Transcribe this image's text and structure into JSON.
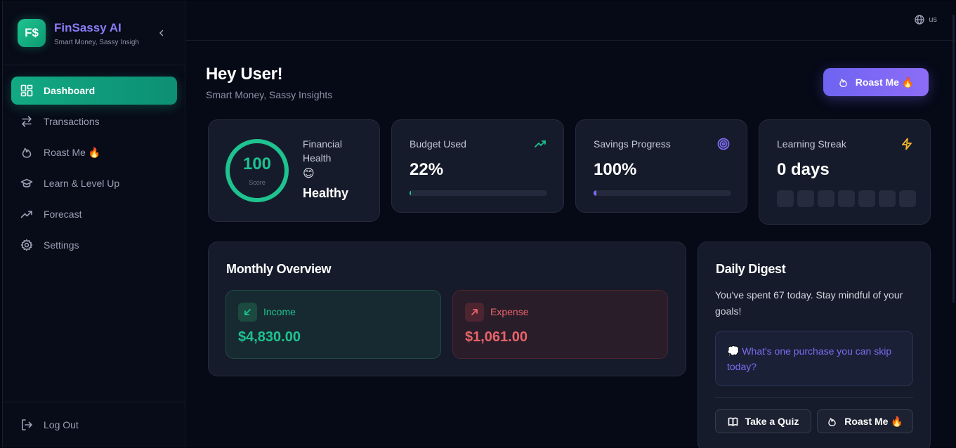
{
  "brand": {
    "logo": "F$",
    "name": "FinSassy AI",
    "tagline": "Smart Money, Sassy Insigh"
  },
  "nav": [
    {
      "label": "Dashboard",
      "icon": "dashboard-icon"
    },
    {
      "label": "Transactions",
      "icon": "arrows-icon"
    },
    {
      "label": "Roast Me 🔥",
      "icon": "flame-icon"
    },
    {
      "label": "Learn & Level Up",
      "icon": "graduation-cap-icon"
    },
    {
      "label": "Forecast",
      "icon": "trend-icon"
    },
    {
      "label": "Settings",
      "icon": "gear-icon"
    }
  ],
  "logout_label": "Log Out",
  "lang": "us",
  "header": {
    "greeting": "Hey User!",
    "subtitle": "Smart Money, Sassy Insights",
    "roast_button": "Roast Me 🔥"
  },
  "health": {
    "score": "100",
    "score_label": "Score",
    "label": "Financial Health",
    "emoji": "😊",
    "status": "Healthy",
    "progress": 1.0
  },
  "budget": {
    "label": "Budget Used",
    "value": "22%",
    "progress": 0.01
  },
  "savings": {
    "label": "Savings Progress",
    "value": "100%",
    "progress": 0.02
  },
  "streak": {
    "label": "Learning Streak",
    "value": "0 days",
    "days": 7
  },
  "overview": {
    "title": "Monthly Overview",
    "income": {
      "label": "Income",
      "value": "$4,830.00"
    },
    "expense": {
      "label": "Expense",
      "value": "$1,061.00"
    }
  },
  "digest": {
    "title": "Daily Digest",
    "text": "You've spent 67 today. Stay mindful of your goals!",
    "question": "💭 What's one purchase you can skip today?",
    "quiz_button": "Take a Quiz",
    "roast_button": "Roast Me 🔥"
  },
  "colors": {
    "accent": "#1ec38f",
    "purple": "#7c6cf0",
    "expense": "#e8646a"
  }
}
